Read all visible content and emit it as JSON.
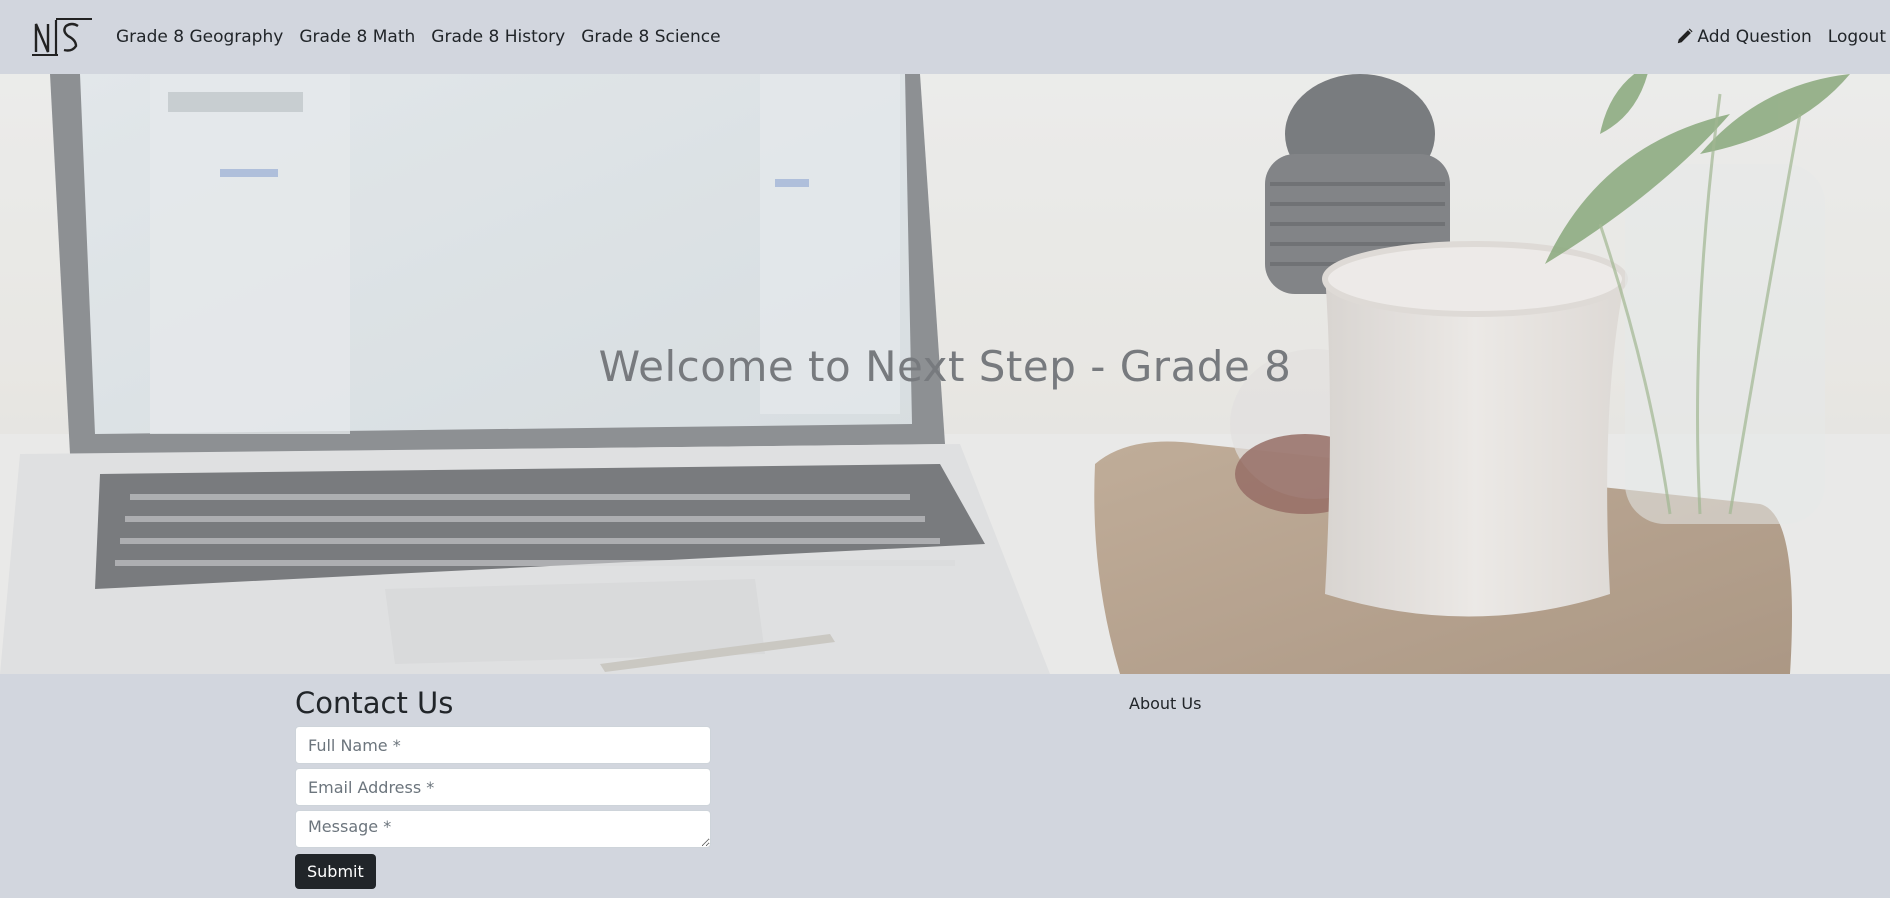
{
  "navbar": {
    "logo_text": "NS",
    "links": [
      {
        "label": "Grade 8 Geography"
      },
      {
        "label": "Grade 8 Math"
      },
      {
        "label": "Grade 8 History"
      },
      {
        "label": "Grade 8 Science"
      }
    ],
    "add_question_label": "Add Question",
    "add_question_icon": "pencil-icon",
    "logout_label": "Logout"
  },
  "hero": {
    "title": "Welcome to Next Step - Grade 8"
  },
  "footer": {
    "contact_title": "Contact Us",
    "full_name_placeholder": "Full Name *",
    "email_placeholder": "Email Address *",
    "message_placeholder": "Message *",
    "submit_label": "Submit",
    "about_label": "About Us"
  },
  "colors": {
    "navbar_bg": "#d2d6de",
    "footer_bg": "#d2d6de",
    "submit_bg": "#212529",
    "hero_title": "#777a7e"
  }
}
